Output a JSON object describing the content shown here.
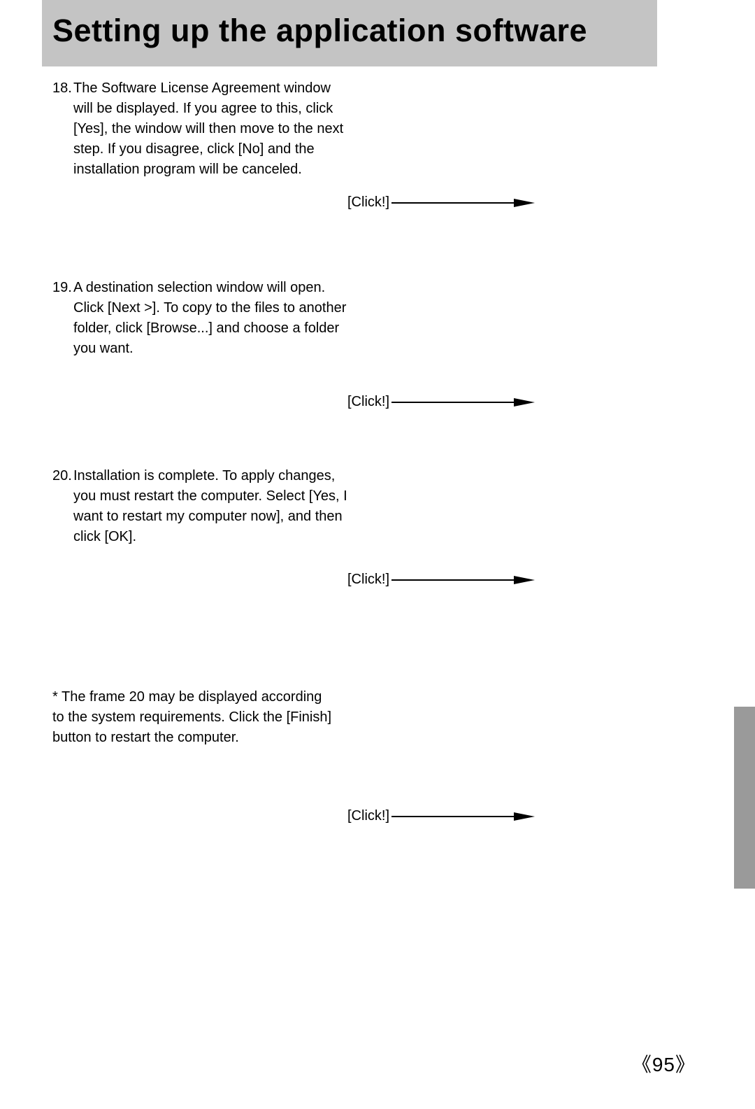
{
  "title": "Setting up the application software",
  "steps": [
    {
      "number": "18.",
      "text": "The Software License Agreement window will be displayed. If you agree to this, click [Yes], the window will then move to the next step. If you disagree, click [No] and the installation program will be canceled."
    },
    {
      "number": "19.",
      "text": "A destination selection window will open. Click [Next >]. To copy to the files to another folder, click [Browse...] and choose a folder you want."
    },
    {
      "number": "20.",
      "text": "Installation is complete. To apply changes, you must restart the computer. Select [Yes, I want to restart my computer now], and then click [OK]."
    }
  ],
  "note": {
    "prefix": "* ",
    "text": "The frame 20 may be displayed according to the system requirements. Click the [Finish] button to restart the computer."
  },
  "click_label": "[Click!]",
  "page_number": "95",
  "brackets": {
    "left": "《",
    "right": "》"
  }
}
